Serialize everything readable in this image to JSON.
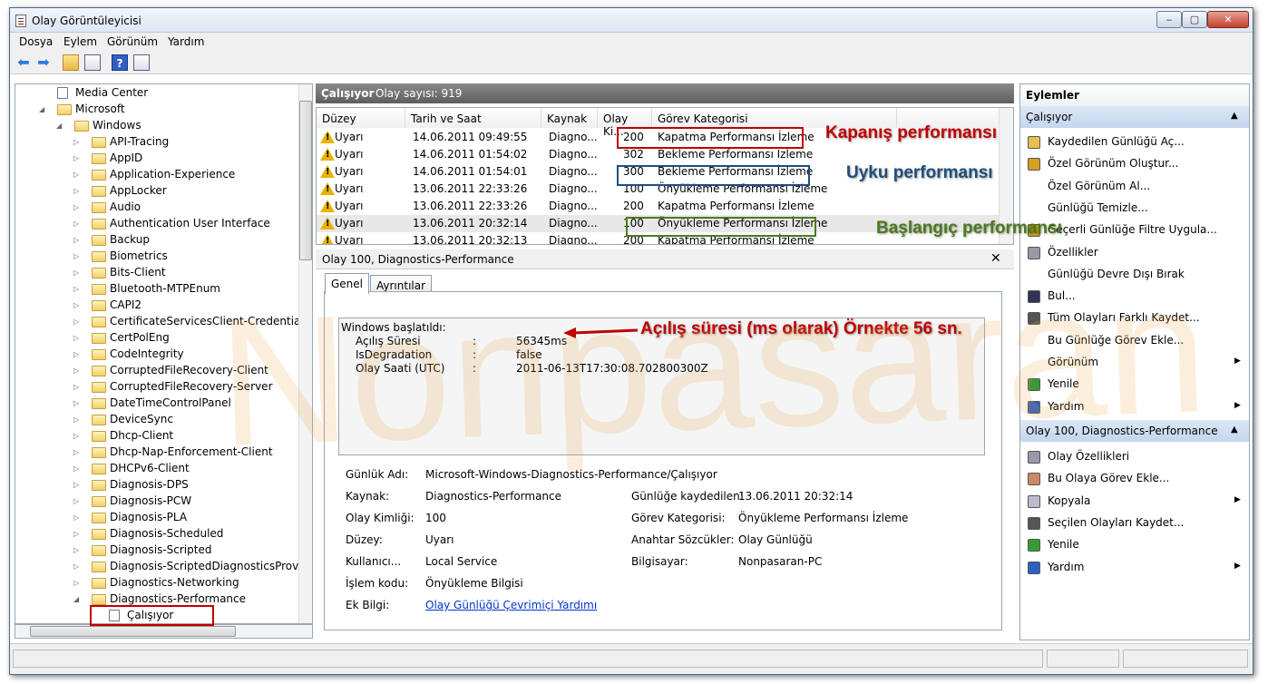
{
  "window": {
    "title": "Olay Görüntüleyicisi",
    "min": "‒",
    "max": "▢",
    "close": "✕"
  },
  "menu": [
    "Dosya",
    "Eylem",
    "Görünüm",
    "Yardım"
  ],
  "tree": [
    {
      "label": "Media Center",
      "indent": 0,
      "twisty": "",
      "icon": "log"
    },
    {
      "label": "Microsoft",
      "indent": 0,
      "twisty": "◢",
      "icon": "folder"
    },
    {
      "label": "Windows",
      "indent": 1,
      "twisty": "◢",
      "icon": "folder"
    },
    {
      "label": "API-Tracing",
      "indent": 2,
      "twisty": "▷",
      "icon": "folder"
    },
    {
      "label": "AppID",
      "indent": 2,
      "twisty": "▷",
      "icon": "folder"
    },
    {
      "label": "Application-Experience",
      "indent": 2,
      "twisty": "▷",
      "icon": "folder"
    },
    {
      "label": "AppLocker",
      "indent": 2,
      "twisty": "▷",
      "icon": "folder"
    },
    {
      "label": "Audio",
      "indent": 2,
      "twisty": "▷",
      "icon": "folder"
    },
    {
      "label": "Authentication User Interface",
      "indent": 2,
      "twisty": "▷",
      "icon": "folder"
    },
    {
      "label": "Backup",
      "indent": 2,
      "twisty": "▷",
      "icon": "folder"
    },
    {
      "label": "Biometrics",
      "indent": 2,
      "twisty": "▷",
      "icon": "folder"
    },
    {
      "label": "Bits-Client",
      "indent": 2,
      "twisty": "▷",
      "icon": "folder"
    },
    {
      "label": "Bluetooth-MTPEnum",
      "indent": 2,
      "twisty": "▷",
      "icon": "folder"
    },
    {
      "label": "CAPI2",
      "indent": 2,
      "twisty": "▷",
      "icon": "folder"
    },
    {
      "label": "CertificateServicesClient-CredentialRoa",
      "indent": 2,
      "twisty": "▷",
      "icon": "folder"
    },
    {
      "label": "CertPolEng",
      "indent": 2,
      "twisty": "▷",
      "icon": "folder"
    },
    {
      "label": "CodeIntegrity",
      "indent": 2,
      "twisty": "▷",
      "icon": "folder"
    },
    {
      "label": "CorruptedFileRecovery-Client",
      "indent": 2,
      "twisty": "▷",
      "icon": "folder"
    },
    {
      "label": "CorruptedFileRecovery-Server",
      "indent": 2,
      "twisty": "▷",
      "icon": "folder"
    },
    {
      "label": "DateTimeControlPanel",
      "indent": 2,
      "twisty": "▷",
      "icon": "folder"
    },
    {
      "label": "DeviceSync",
      "indent": 2,
      "twisty": "▷",
      "icon": "folder"
    },
    {
      "label": "Dhcp-Client",
      "indent": 2,
      "twisty": "▷",
      "icon": "folder"
    },
    {
      "label": "Dhcp-Nap-Enforcement-Client",
      "indent": 2,
      "twisty": "▷",
      "icon": "folder"
    },
    {
      "label": "DHCPv6-Client",
      "indent": 2,
      "twisty": "▷",
      "icon": "folder"
    },
    {
      "label": "Diagnosis-DPS",
      "indent": 2,
      "twisty": "▷",
      "icon": "folder"
    },
    {
      "label": "Diagnosis-PCW",
      "indent": 2,
      "twisty": "▷",
      "icon": "folder"
    },
    {
      "label": "Diagnosis-PLA",
      "indent": 2,
      "twisty": "▷",
      "icon": "folder"
    },
    {
      "label": "Diagnosis-Scheduled",
      "indent": 2,
      "twisty": "▷",
      "icon": "folder"
    },
    {
      "label": "Diagnosis-Scripted",
      "indent": 2,
      "twisty": "▷",
      "icon": "folder"
    },
    {
      "label": "Diagnosis-ScriptedDiagnosticsProvider",
      "indent": 2,
      "twisty": "▷",
      "icon": "folder"
    },
    {
      "label": "Diagnostics-Networking",
      "indent": 2,
      "twisty": "▷",
      "icon": "folder"
    },
    {
      "label": "Diagnostics-Performance",
      "indent": 2,
      "twisty": "◢",
      "icon": "folder"
    },
    {
      "label": "Çalışıyor",
      "indent": 3,
      "twisty": "",
      "icon": "log"
    }
  ],
  "center": {
    "title": "Çalışıyor",
    "count": "Olay sayısı: 919"
  },
  "columns": [
    "Düzey",
    "Tarih ve Saat",
    "Kaynak",
    "Olay Ki...",
    "Görev Kategorisi"
  ],
  "events": [
    {
      "level": "Uyarı",
      "date": "14.06.2011 09:49:55",
      "source": "Diagno...",
      "id": "200",
      "cat": "Kapatma Performansı İzleme"
    },
    {
      "level": "Uyarı",
      "date": "14.06.2011 01:54:02",
      "source": "Diagno...",
      "id": "302",
      "cat": "Bekleme Performansı İzleme"
    },
    {
      "level": "Uyarı",
      "date": "14.06.2011 01:54:01",
      "source": "Diagno...",
      "id": "300",
      "cat": "Bekleme Performansı İzleme"
    },
    {
      "level": "Uyarı",
      "date": "13.06.2011 22:33:26",
      "source": "Diagno...",
      "id": "100",
      "cat": "Önyükleme Performansı İzleme"
    },
    {
      "level": "Uyarı",
      "date": "13.06.2011 22:33:26",
      "source": "Diagno...",
      "id": "200",
      "cat": "Kapatma Performansı İzleme"
    },
    {
      "level": "Uyarı",
      "date": "13.06.2011 20:32:14",
      "source": "Diagno...",
      "id": "100",
      "cat": "Önyükleme Performansı İzleme"
    },
    {
      "level": "Uyarı",
      "date": "13.06.2011 20:32:13",
      "source": "Diagno...",
      "id": "200",
      "cat": "Kapatma Performansı İzleme"
    }
  ],
  "detail": {
    "title": "Olay 100, Diagnostics-Performance",
    "tabs": [
      "Genel",
      "Ayrıntılar"
    ],
    "desc": {
      "head": "Windows başlatıldı:",
      "lines": [
        {
          "k": "Açılış Süresi",
          "sep": ":",
          "v": "56345ms"
        },
        {
          "k": "IsDegradation",
          "sep": ":",
          "v": "false"
        },
        {
          "k": "Olay Saati (UTC)",
          "sep": ":",
          "v": "2011-06-13T17:30:08.702800300Z"
        }
      ]
    },
    "left": [
      {
        "k": "Günlük Adı:",
        "v": "Microsoft-Windows-Diagnostics-Performance/Çalışıyor"
      },
      {
        "k": "Kaynak:",
        "v": "Diagnostics-Performance"
      },
      {
        "k": "Olay Kimliği:",
        "v": "100"
      },
      {
        "k": "Düzey:",
        "v": "Uyarı"
      },
      {
        "k": "Kullanıcı...",
        "v": "Local Service"
      },
      {
        "k": "İşlem kodu:",
        "v": "Önyükleme Bilgisi"
      },
      {
        "k": "Ek Bilgi:",
        "v": "Olay Günlüğü Çevrimiçi Yardımı"
      }
    ],
    "right": [
      {
        "k": "Günlüğe kaydedilen:",
        "v": "13.06.2011 20:32:14"
      },
      {
        "k": "Görev Kategorisi:",
        "v": "Önyükleme Performansı İzleme"
      },
      {
        "k": "Anahtar Sözcükler:",
        "v": "Olay Günlüğü"
      },
      {
        "k": "Bilgisayar:",
        "v": "Nonpasaran-PC"
      }
    ]
  },
  "actions": {
    "title": "Eylemler",
    "group1": "Çalışıyor",
    "items1": [
      {
        "label": "Kaydedilen Günlüğü Aç...",
        "icon": "open-folder-icon",
        "sub": false
      },
      {
        "label": "Özel Görünüm Oluştur...",
        "icon": "filter-icon",
        "sub": false
      },
      {
        "label": "Özel Görünüm Al...",
        "icon": "",
        "sub": false
      },
      {
        "label": "Günlüğü Temizle...",
        "icon": "",
        "sub": false
      },
      {
        "label": "Geçerli Günlüğe Filtre Uygula...",
        "icon": "filter-icon",
        "sub": false
      },
      {
        "label": "Özellikler",
        "icon": "properties-icon",
        "sub": false
      },
      {
        "label": "Günlüğü Devre Dışı Bırak",
        "icon": "",
        "sub": false
      },
      {
        "label": "Bul...",
        "icon": "binoculars-icon",
        "sub": false
      },
      {
        "label": "Tüm Olayları Farklı Kaydet...",
        "icon": "save-icon",
        "sub": false
      },
      {
        "label": "Bu Günlüğe Görev Ekle...",
        "icon": "",
        "sub": false
      },
      {
        "label": "Görünüm",
        "icon": "",
        "sub": true
      },
      {
        "label": "Yenile",
        "icon": "refresh-icon",
        "sub": false
      },
      {
        "label": "Yardım",
        "icon": "help-icon",
        "sub": true
      }
    ],
    "group2": "Olay 100, Diagnostics-Performance",
    "items2": [
      {
        "label": "Olay Özellikleri",
        "icon": "properties-icon",
        "sub": false
      },
      {
        "label": "Bu Olaya Görev Ekle...",
        "icon": "task-icon",
        "sub": false
      },
      {
        "label": "Kopyala",
        "icon": "copy-icon",
        "sub": true
      },
      {
        "label": "Seçilen Olayları Kaydet...",
        "icon": "save-icon",
        "sub": false
      },
      {
        "label": "Yenile",
        "icon": "refresh-icon",
        "sub": false
      },
      {
        "label": "Yardım",
        "icon": "help-icon",
        "sub": true
      }
    ]
  },
  "annotations": {
    "shutdown": "Kapanış performansı",
    "sleep": "Uyku performansı",
    "boot": "Başlangıç performansı",
    "boottime": "Açılış süresi (ms olarak) Örnekte 56 sn.",
    "watermark": "Nonpasaran",
    "colors": {
      "red": "#c00000",
      "blue": "#1f4e79",
      "green": "#4a7a1e"
    }
  }
}
